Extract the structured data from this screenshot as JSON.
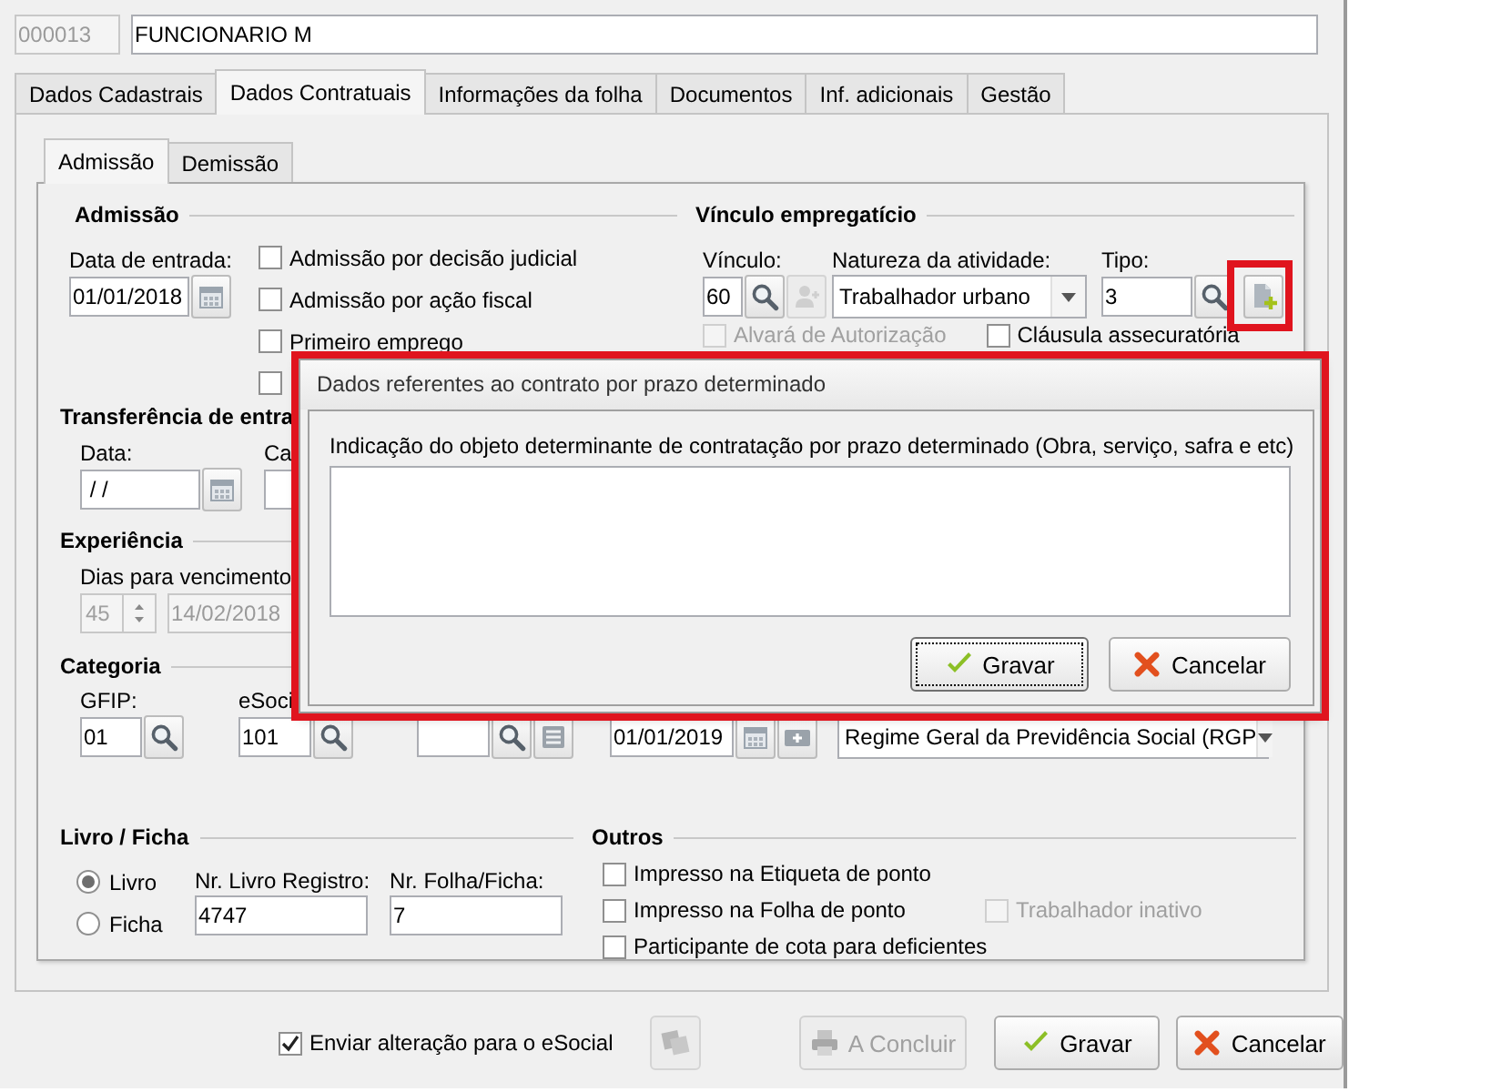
{
  "employee": {
    "code": {
      "value": "000013",
      "disabled": true
    },
    "name": {
      "value": "FUNCIONARIO M",
      "disabled": false
    }
  },
  "tabs": [
    {
      "label": "Dados Cadastrais",
      "selected": false
    },
    {
      "label": "Dados Contratuais",
      "selected": true
    },
    {
      "label": "Informações da folha",
      "selected": false
    },
    {
      "label": "Documentos",
      "selected": false
    },
    {
      "label": "Inf. adicionais",
      "selected": false
    },
    {
      "label": "Gestão",
      "selected": false
    }
  ],
  "sub_tabs": [
    {
      "label": "Admissão",
      "selected": true
    },
    {
      "label": "Demissão",
      "selected": false
    }
  ],
  "admissao": {
    "title": "Admissão",
    "date_label": "Data de entrada:",
    "date": "01/01/2018",
    "options": [
      {
        "label": "Admissão por decisão judicial",
        "checked": false
      },
      {
        "label": "Admissão por ação fiscal",
        "checked": false
      },
      {
        "label": "Primeiro emprego",
        "checked": false
      },
      {
        "checked": false
      }
    ]
  },
  "vinculo": {
    "title": "Vínculo empregatício",
    "vinculo_label": "Vínculo:",
    "vinculo": "60",
    "natureza_label": "Natureza da atividade:",
    "natureza": "Trabalhador urbano",
    "tipo_label": "Tipo:",
    "tipo": "3",
    "add_highlighted": true,
    "options": [
      {
        "label": "Alvará de Autorização",
        "checked": false,
        "disabled": true
      },
      {
        "label": "Cláusula assecuratória",
        "checked": false,
        "disabled": false
      }
    ]
  },
  "transferencia": {
    "title": "Transferência de entra",
    "data_label": "Data:",
    "data": " / /",
    "column_2_label": "Ca"
  },
  "experiencia": {
    "title": "Experiência",
    "dias_label": "Dias para vencimento",
    "dias": "45",
    "vencimento": "14/02/2018",
    "disabled": true
  },
  "categoria": {
    "title": "Categoria",
    "gfip_label": "GFIP:",
    "gfip": "01",
    "esocial_label": "eSoci",
    "esocial": "101",
    "date": "01/01/2019",
    "regime": "Regime Geral da Previdência Social (RGP"
  },
  "livro": {
    "title": "Livro / Ficha",
    "options": [
      {
        "label": "Livro",
        "selected": true
      },
      {
        "label": "Ficha",
        "selected": false
      }
    ],
    "registro_label": "Nr. Livro Registro:",
    "registro": "4747",
    "folha_label": "Nr. Folha/Ficha:",
    "folha": "7"
  },
  "outros": {
    "title": "Outros",
    "options": [
      {
        "label": "Impresso na Etiqueta de ponto",
        "checked": false,
        "disabled": false
      },
      {
        "label": "Impresso na Folha de ponto",
        "checked": false,
        "disabled": false
      },
      {
        "label": "Participante de cota para deficientes",
        "checked": false,
        "disabled": false
      }
    ],
    "side_option": {
      "label": "Trabalhador inativo",
      "checked": false,
      "disabled": true
    }
  },
  "footer": {
    "esocial": {
      "label": "Enviar alteração para o eSocial",
      "checked": true
    },
    "buttons": [
      {
        "label": "A Concluir",
        "kind": "conclude",
        "disabled": true
      },
      {
        "label": "Gravar",
        "kind": "save",
        "disabled": false
      },
      {
        "label": "Cancelar",
        "kind": "cancel",
        "disabled": false
      }
    ]
  },
  "dialog": {
    "title": "Dados referentes ao contrato por prazo determinado",
    "field_label": "Indicação do objeto determinante de contratação por prazo determinado (Obra, serviço, safra e etc)",
    "highlighted": true,
    "buttons": [
      {
        "label": "Gravar",
        "kind": "save",
        "focused": true
      },
      {
        "label": "Cancelar",
        "kind": "cancel",
        "focused": false
      }
    ]
  }
}
